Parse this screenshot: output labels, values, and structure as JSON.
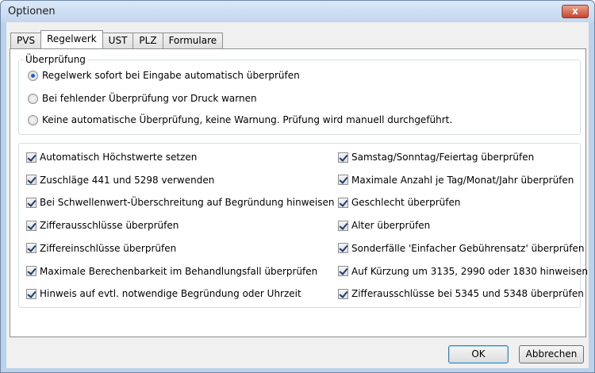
{
  "window": {
    "title": "Optionen",
    "close_label": "x"
  },
  "tabs": [
    {
      "label": "PVS"
    },
    {
      "label": "Regelwerk"
    },
    {
      "label": "UST"
    },
    {
      "label": "PLZ"
    },
    {
      "label": "Formulare"
    }
  ],
  "ueberpruefung": {
    "title": "Überprüfung",
    "options": [
      {
        "label": "Regelwerk sofort bei Eingabe automatisch überprüfen",
        "checked": true
      },
      {
        "label": "Bei fehlender Überprüfung vor Druck warnen",
        "checked": false
      },
      {
        "label": "Keine automatische Überprüfung, keine Warnung. Prüfung wird manuell durchgeführt.",
        "checked": false
      }
    ]
  },
  "checks_left": [
    {
      "label": "Automatisch Höchstwerte setzen",
      "checked": true
    },
    {
      "label": "Zuschläge 441 und 5298 verwenden",
      "checked": true
    },
    {
      "label": "Bei Schwellenwert-Überschreitung auf Begründung hinweisen",
      "checked": true
    },
    {
      "label": "Zifferausschlüsse überprüfen",
      "checked": true
    },
    {
      "label": "Ziffereinschlüsse überprüfen",
      "checked": true
    },
    {
      "label": "Maximale Berechenbarkeit im Behandlungsfall überprüfen",
      "checked": true
    },
    {
      "label": "Hinweis auf evtl. notwendige Begründung oder Uhrzeit",
      "checked": true
    }
  ],
  "checks_right": [
    {
      "label": "Samstag/Sonntag/Feiertag überprüfen",
      "checked": true
    },
    {
      "label": "Maximale Anzahl je Tag/Monat/Jahr überprüfen",
      "checked": true
    },
    {
      "label": "Geschlecht überprüfen",
      "checked": true
    },
    {
      "label": "Alter überprüfen",
      "checked": true
    },
    {
      "label": "Sonderfälle 'Einfacher Gebührensatz' überprüfen",
      "checked": true
    },
    {
      "label": "Auf Kürzung um 3135, 2990 oder 1830 hinweisen",
      "checked": true
    },
    {
      "label": "Zifferausschlüsse bei 5345 und 5348 überprüfen",
      "checked": true
    }
  ],
  "buttons": {
    "ok": "OK",
    "cancel": "Abbrechen"
  }
}
